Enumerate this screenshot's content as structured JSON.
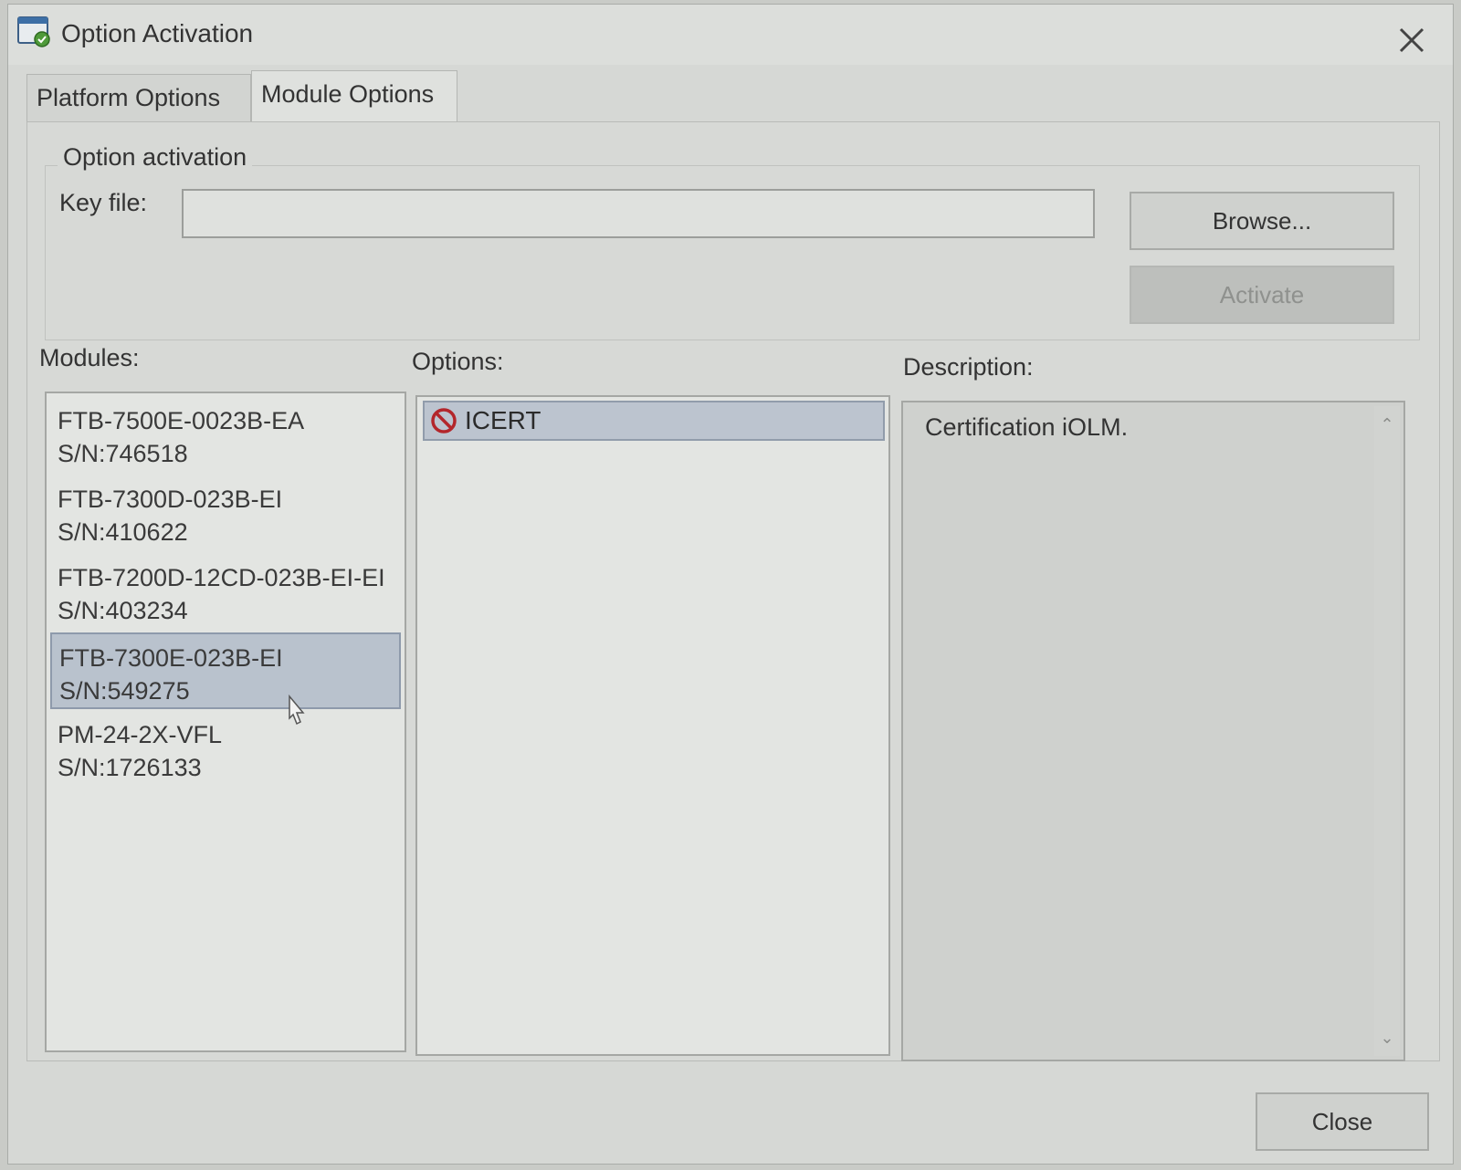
{
  "window": {
    "title": "Option Activation"
  },
  "tabs": [
    {
      "label": "Platform Options"
    },
    {
      "label": "Module Options"
    }
  ],
  "activation": {
    "group_title": "Option activation",
    "key_file_label": "Key file:",
    "key_file_value": "",
    "browse_label": "Browse...",
    "activate_label": "Activate"
  },
  "modules": {
    "label": "Modules:",
    "items": [
      {
        "name": "FTB-7500E-0023B-EA",
        "serial": "S/N:746518"
      },
      {
        "name": "FTB-7300D-023B-EI",
        "serial": "S/N:410622"
      },
      {
        "name": "FTB-7200D-12CD-023B-EI-EI",
        "serial": "S/N:403234"
      },
      {
        "name": "FTB-7300E-023B-EI",
        "serial": "S/N:549275"
      },
      {
        "name": "PM-24-2X-VFL",
        "serial": "S/N:1726133"
      }
    ]
  },
  "options": {
    "label": "Options:",
    "items": [
      {
        "label": "ICERT",
        "icon": "no-entry-icon"
      }
    ]
  },
  "description": {
    "label": "Description:",
    "text": "Certification iOLM."
  },
  "footer": {
    "close_label": "Close"
  }
}
